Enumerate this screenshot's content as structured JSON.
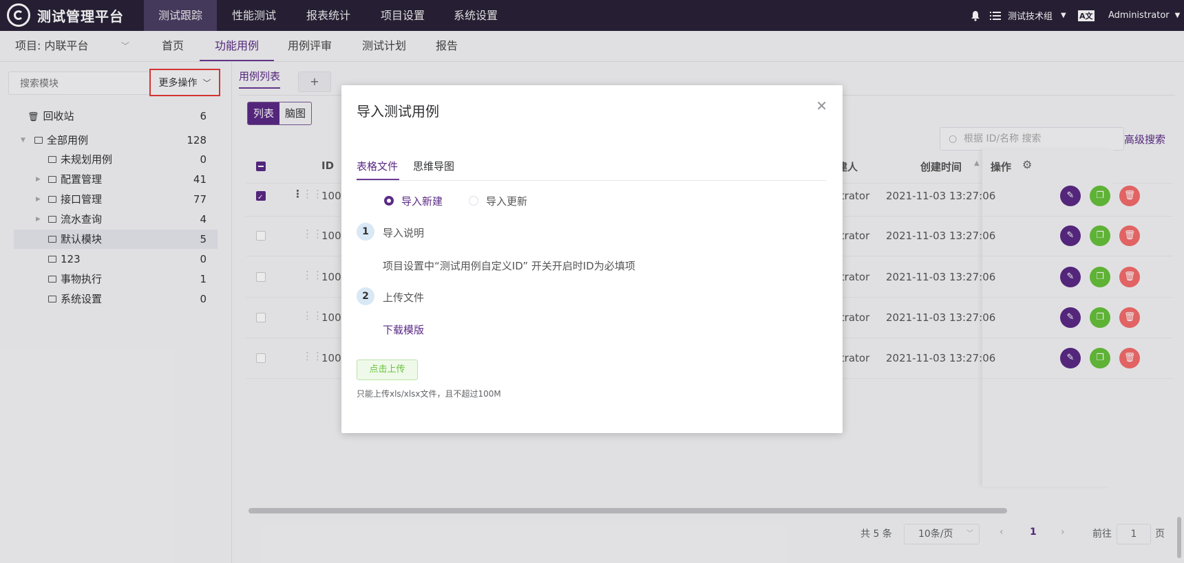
{
  "topnav": {
    "logo_text": "测试管理平台",
    "items": [
      "测试跟踪",
      "性能测试",
      "报表统计",
      "项目设置",
      "系统设置"
    ],
    "group": "测试技术组",
    "lang": "A文",
    "user": "Administrator"
  },
  "subnav": {
    "project": "项目: 内联平台",
    "items": [
      "首页",
      "功能用例",
      "用例评审",
      "测试计划",
      "报告"
    ]
  },
  "sidebar": {
    "search_placeholder": "搜索模块",
    "more_ops": "更多操作",
    "tree": [
      {
        "label": "回收站",
        "count": "6"
      },
      {
        "label": "全部用例",
        "count": "128"
      },
      {
        "label": "未规划用例",
        "count": "0"
      },
      {
        "label": "配置管理",
        "count": "41"
      },
      {
        "label": "接口管理",
        "count": "77"
      },
      {
        "label": "流水查询",
        "count": "4"
      },
      {
        "label": "默认模块",
        "count": "5"
      },
      {
        "label": "123",
        "count": "0"
      },
      {
        "label": "事物执行",
        "count": "1"
      },
      {
        "label": "系统设置",
        "count": "0"
      }
    ]
  },
  "main": {
    "tab": "用例列表",
    "plus": "+",
    "view_list": "列表",
    "view_mind": "脑图",
    "search_placeholder": "根据 ID/名称 搜索",
    "adv_search": "高级搜索",
    "columns": {
      "id": "ID",
      "creator": "创建人",
      "created": "创建时间",
      "ops": "操作"
    },
    "rows": [
      {
        "id": "100",
        "creator": "Administrator",
        "created": "2021-11-03 13:27:06"
      },
      {
        "id": "100",
        "creator": "Administrator",
        "created": "2021-11-03 13:27:06"
      },
      {
        "id": "100",
        "creator": "Administrator",
        "created": "2021-11-03 13:27:06"
      },
      {
        "id": "100",
        "creator": "Administrator",
        "created": "2021-11-03 13:27:06"
      },
      {
        "id": "100",
        "creator": "Administrator",
        "created": "2021-11-03 13:27:06"
      }
    ]
  },
  "pager": {
    "total": "共 5 条",
    "size": "10条/页",
    "page": "1",
    "goto": "前往",
    "goto_value": "1",
    "page_unit": "页"
  },
  "dialog": {
    "title": "导入测试用例",
    "tabs": [
      "表格文件",
      "思维导图"
    ],
    "radio_new": "导入新建",
    "radio_update": "导入更新",
    "step1_num": "1",
    "step1_title": "导入说明",
    "step1_desc": "项目设置中“测试用例自定义ID” 开关开启时ID为必填项",
    "step2_num": "2",
    "step2_title": "上传文件",
    "download": "下载模版",
    "upload_btn": "点击上传",
    "upload_tip": "只能上传xls/xlsx文件，且不超过100M"
  },
  "colors": {
    "primary": "#5b2a86",
    "nav_bg": "#2a2238",
    "edit": "#5b2a86",
    "copy": "#67c23a",
    "delete": "#f56c6c"
  }
}
